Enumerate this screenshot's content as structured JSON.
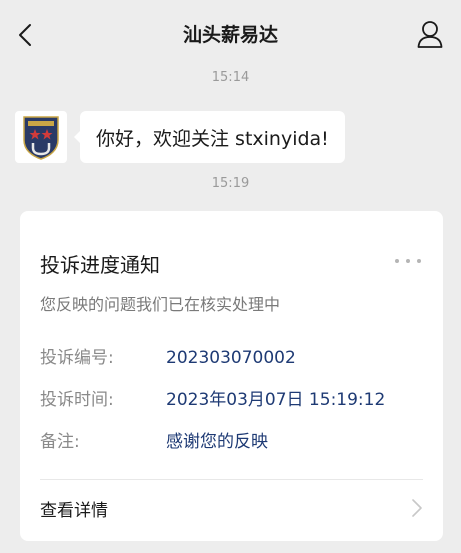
{
  "header": {
    "title": "汕头薪易达",
    "back_icon": "chevron-left-icon",
    "profile_icon": "person-icon"
  },
  "chat": {
    "timestamps": [
      "15:14",
      "15:19"
    ],
    "greeting": {
      "text": "你好，欢迎关注 stxinyida!",
      "avatar_icon": "badge-icon"
    }
  },
  "card": {
    "title": "投诉进度通知",
    "subtitle": "您反映的问题我们已在核实处理中",
    "fields": [
      {
        "label": "投诉编号:",
        "value": "202303070002"
      },
      {
        "label": "投诉时间:",
        "value": "2023年03月07日 15:19:12"
      },
      {
        "label": "备注:",
        "value": "感谢您的反映"
      }
    ],
    "detail_label": "查看详情",
    "more_icon": "more-dots-icon",
    "detail_icon": "chevron-right-icon"
  },
  "colors": {
    "background": "#ededed",
    "card": "#ffffff",
    "value_text": "#1e3a74",
    "muted_text": "#8a8a8a"
  }
}
